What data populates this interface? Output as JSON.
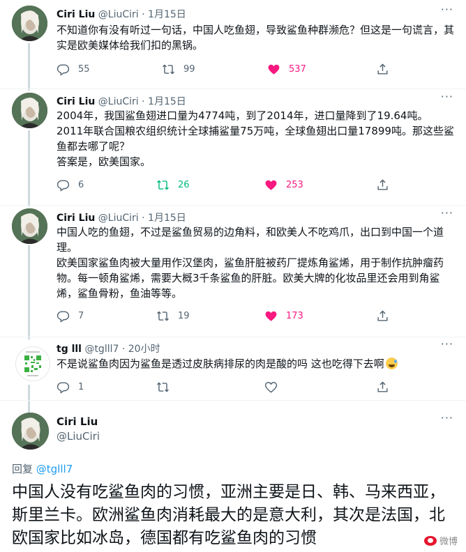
{
  "tweets": [
    {
      "name": "Ciri Liu",
      "handle": "@LiuCiri",
      "sep": "·",
      "date": "1月15日",
      "text": "不知道你有没有听过一句话，中国人吃鱼翅，导致鲨鱼种群濒危？但这是一句谎言，其实是欧美媒体给我们扣的黑锅。",
      "replies": "55",
      "retweets": "99",
      "likes": "537"
    },
    {
      "name": "Ciri Liu",
      "handle": "@LiuCiri",
      "sep": "·",
      "date": "1月15日",
      "text_lines": [
        "2004年，我国鲨鱼翅进口量为4774吨，到了2014年，进口量降到了19.64吨。",
        "2011年联合国粮农组织统计全球捕鲨量75万吨，全球鱼翅出口量17899吨。那这些鲨鱼都去哪了呢？",
        "答案是，欧美国家。"
      ],
      "replies": "6",
      "retweets": "26",
      "likes": "253"
    },
    {
      "name": "Ciri Liu",
      "handle": "@LiuCiri",
      "sep": "·",
      "date": "1月15日",
      "text_lines": [
        "中国人吃的鱼翅，不过是鲨鱼贸易的边角料，和欧美人不吃鸡爪，出口到中国一个道理。",
        "欧美国家鲨鱼肉被大量用作汉堡肉，鲨鱼肝脏被药厂提炼角鲨烯，用于制作抗肿瘤药物。每一顿角鲨烯，需要大概3千条鲨鱼的肝脏。欧美大牌的化妆品里还会用到角鲨烯，鲨鱼骨粉，鱼油等等。"
      ],
      "replies": "7",
      "retweets": "19",
      "likes": "173"
    },
    {
      "name": "tg lll",
      "handle": "@tglll7",
      "sep": "·",
      "date": "20小时",
      "text": "不是说鲨鱼肉因为鲨鱼是透过皮肤病排尿的肉是酸的吗 这也吃得下去啊",
      "replies": "1",
      "retweets": "",
      "likes": ""
    }
  ],
  "main_tweet": {
    "name": "Ciri Liu",
    "handle": "@LiuCiri",
    "reply_prefix": "回复",
    "reply_handle": "@tglll7",
    "text": "中国人没有吃鲨鱼肉的习惯，亚洲主要是日、韩、马来西亚，斯里兰卡。欧洲鲨鱼肉消耗最大的是意大利，其次是法国，北欧国家比如冰岛，德国都有吃鲨鱼肉的习惯"
  },
  "watermark": "微博",
  "colors": {
    "text": "#0f1419",
    "secondary": "#536471",
    "link": "#1d9bf0",
    "retweet_active": "#00ba7c",
    "like_active": "#f91880",
    "divider": "#eff3f4"
  }
}
